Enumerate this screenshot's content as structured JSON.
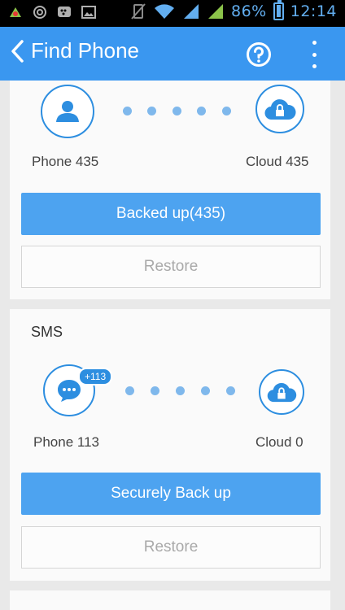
{
  "status_bar": {
    "battery_percent": "86%",
    "time": "12:14"
  },
  "app_bar": {
    "title": "Find Phone",
    "help_icon": "help-circle-icon",
    "more_icon": "more-vert-icon"
  },
  "contacts_card": {
    "phone_label": "Phone 435",
    "cloud_label": "Cloud 435",
    "primary_button": "Backed up(435)",
    "restore_button": "Restore"
  },
  "sms_card": {
    "title": "SMS",
    "badge": "+113",
    "phone_label": "Phone 113",
    "cloud_label": "Cloud 0",
    "primary_button": "Securely Back up",
    "restore_button": "Restore"
  },
  "colors": {
    "accent": "#3a97f0",
    "button": "#4da3f0",
    "icon": "#2d8ee0"
  }
}
